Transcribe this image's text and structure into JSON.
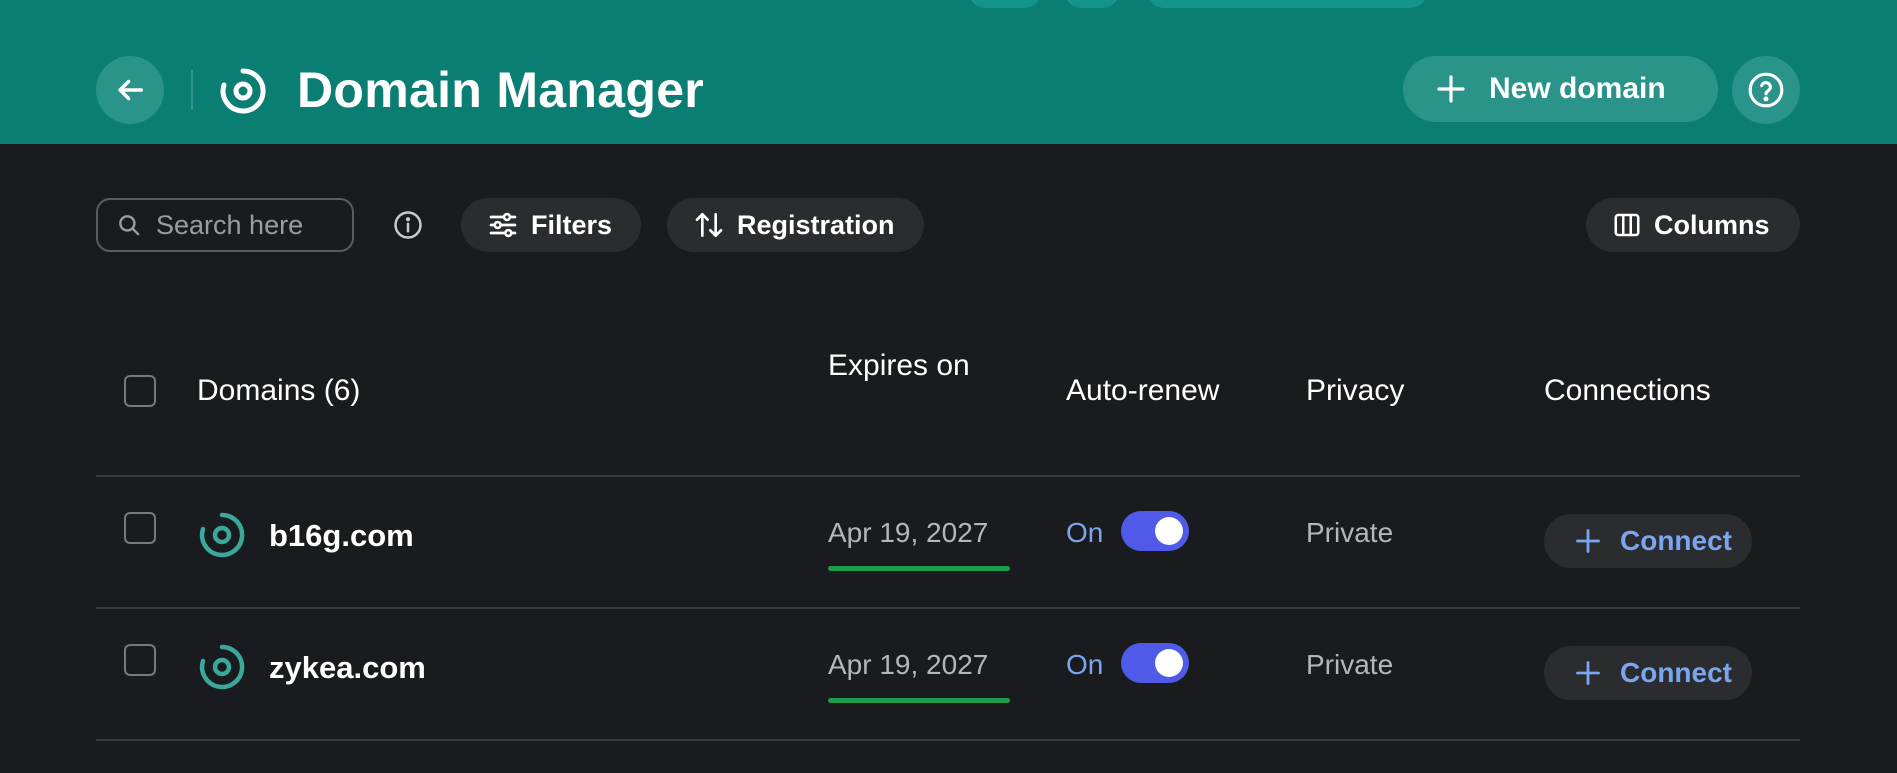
{
  "header": {
    "title": "Domain Manager",
    "new_domain_label": "New domain",
    "background": "#0b7e74"
  },
  "toolbar": {
    "search_placeholder": "Search here",
    "filters_label": "Filters",
    "sort_label": "Registration",
    "columns_label": "Columns"
  },
  "table": {
    "columns": {
      "domains": "Domains (6)",
      "expires": "Expires on",
      "auto_renew": "Auto-renew",
      "privacy": "Privacy",
      "connections": "Connections"
    },
    "rows": [
      {
        "domain": "b16g.com",
        "expires": "Apr 19, 2027",
        "auto_renew": "On",
        "auto_renew_enabled": true,
        "privacy": "Private",
        "connect_label": "Connect"
      },
      {
        "domain": "zykea.com",
        "expires": "Apr 19, 2027",
        "auto_renew": "On",
        "auto_renew_enabled": true,
        "privacy": "Private",
        "connect_label": "Connect"
      }
    ]
  },
  "icons": {
    "back": "arrow-left-icon",
    "domain": "domain-ring-icon",
    "plus": "plus-icon",
    "help": "question-circle-icon",
    "search": "search-icon",
    "info": "info-icon",
    "filters": "sliders-icon",
    "sort": "sort-arrows-icon",
    "columns": "columns-icon"
  },
  "colors": {
    "accent_teal": "#0b7e74",
    "toggle_on": "#4f5be8",
    "link_blue": "#7aa6f0",
    "expiry_bar": "#1f9b4e",
    "domain_icon": "#3aa89a"
  }
}
